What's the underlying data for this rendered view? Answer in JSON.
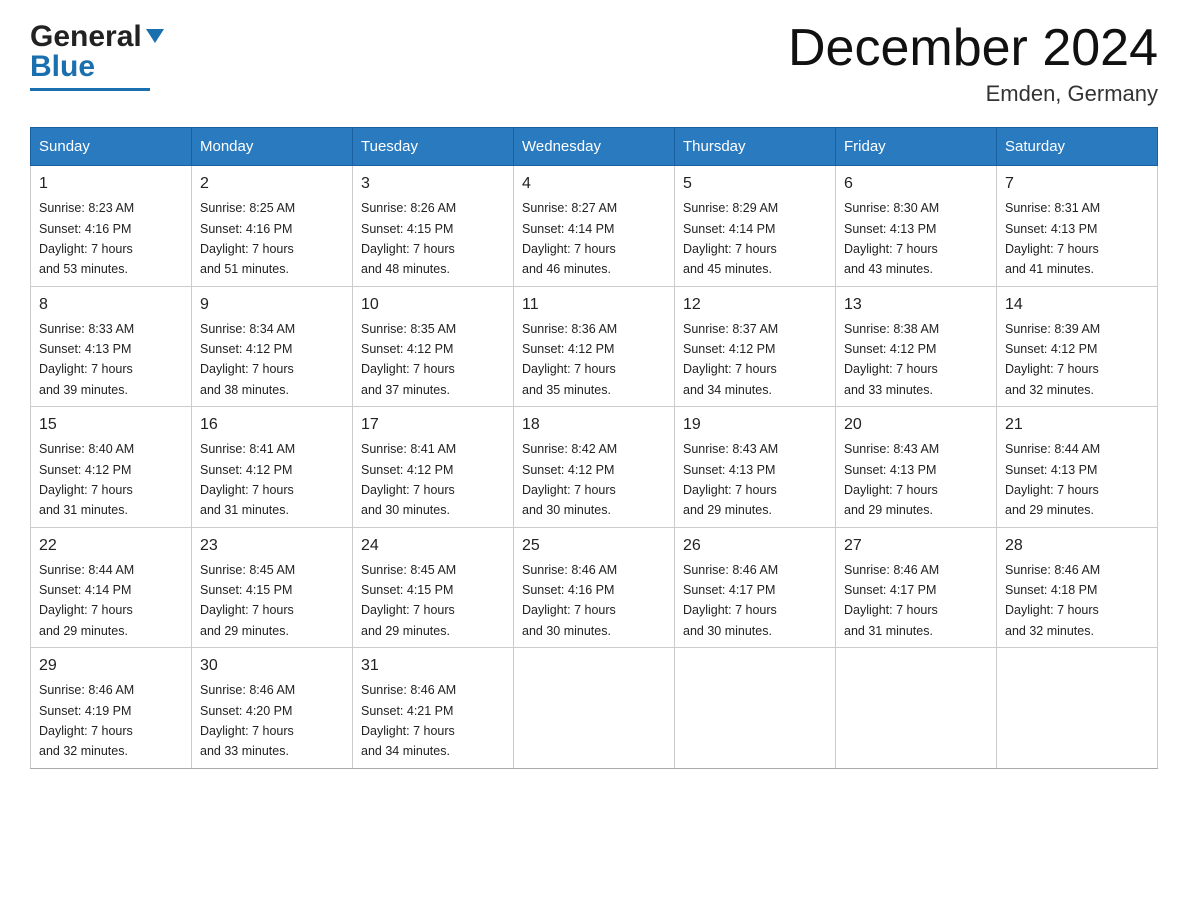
{
  "header": {
    "logo_general": "General",
    "logo_blue": "Blue",
    "title": "December 2024",
    "subtitle": "Emden, Germany"
  },
  "weekdays": [
    "Sunday",
    "Monday",
    "Tuesday",
    "Wednesday",
    "Thursday",
    "Friday",
    "Saturday"
  ],
  "weeks": [
    [
      {
        "day": "1",
        "sunrise": "8:23 AM",
        "sunset": "4:16 PM",
        "daylight": "7 hours and 53 minutes."
      },
      {
        "day": "2",
        "sunrise": "8:25 AM",
        "sunset": "4:16 PM",
        "daylight": "7 hours and 51 minutes."
      },
      {
        "day": "3",
        "sunrise": "8:26 AM",
        "sunset": "4:15 PM",
        "daylight": "7 hours and 48 minutes."
      },
      {
        "day": "4",
        "sunrise": "8:27 AM",
        "sunset": "4:14 PM",
        "daylight": "7 hours and 46 minutes."
      },
      {
        "day": "5",
        "sunrise": "8:29 AM",
        "sunset": "4:14 PM",
        "daylight": "7 hours and 45 minutes."
      },
      {
        "day": "6",
        "sunrise": "8:30 AM",
        "sunset": "4:13 PM",
        "daylight": "7 hours and 43 minutes."
      },
      {
        "day": "7",
        "sunrise": "8:31 AM",
        "sunset": "4:13 PM",
        "daylight": "7 hours and 41 minutes."
      }
    ],
    [
      {
        "day": "8",
        "sunrise": "8:33 AM",
        "sunset": "4:13 PM",
        "daylight": "7 hours and 39 minutes."
      },
      {
        "day": "9",
        "sunrise": "8:34 AM",
        "sunset": "4:12 PM",
        "daylight": "7 hours and 38 minutes."
      },
      {
        "day": "10",
        "sunrise": "8:35 AM",
        "sunset": "4:12 PM",
        "daylight": "7 hours and 37 minutes."
      },
      {
        "day": "11",
        "sunrise": "8:36 AM",
        "sunset": "4:12 PM",
        "daylight": "7 hours and 35 minutes."
      },
      {
        "day": "12",
        "sunrise": "8:37 AM",
        "sunset": "4:12 PM",
        "daylight": "7 hours and 34 minutes."
      },
      {
        "day": "13",
        "sunrise": "8:38 AM",
        "sunset": "4:12 PM",
        "daylight": "7 hours and 33 minutes."
      },
      {
        "day": "14",
        "sunrise": "8:39 AM",
        "sunset": "4:12 PM",
        "daylight": "7 hours and 32 minutes."
      }
    ],
    [
      {
        "day": "15",
        "sunrise": "8:40 AM",
        "sunset": "4:12 PM",
        "daylight": "7 hours and 31 minutes."
      },
      {
        "day": "16",
        "sunrise": "8:41 AM",
        "sunset": "4:12 PM",
        "daylight": "7 hours and 31 minutes."
      },
      {
        "day": "17",
        "sunrise": "8:41 AM",
        "sunset": "4:12 PM",
        "daylight": "7 hours and 30 minutes."
      },
      {
        "day": "18",
        "sunrise": "8:42 AM",
        "sunset": "4:12 PM",
        "daylight": "7 hours and 30 minutes."
      },
      {
        "day": "19",
        "sunrise": "8:43 AM",
        "sunset": "4:13 PM",
        "daylight": "7 hours and 29 minutes."
      },
      {
        "day": "20",
        "sunrise": "8:43 AM",
        "sunset": "4:13 PM",
        "daylight": "7 hours and 29 minutes."
      },
      {
        "day": "21",
        "sunrise": "8:44 AM",
        "sunset": "4:13 PM",
        "daylight": "7 hours and 29 minutes."
      }
    ],
    [
      {
        "day": "22",
        "sunrise": "8:44 AM",
        "sunset": "4:14 PM",
        "daylight": "7 hours and 29 minutes."
      },
      {
        "day": "23",
        "sunrise": "8:45 AM",
        "sunset": "4:15 PM",
        "daylight": "7 hours and 29 minutes."
      },
      {
        "day": "24",
        "sunrise": "8:45 AM",
        "sunset": "4:15 PM",
        "daylight": "7 hours and 29 minutes."
      },
      {
        "day": "25",
        "sunrise": "8:46 AM",
        "sunset": "4:16 PM",
        "daylight": "7 hours and 30 minutes."
      },
      {
        "day": "26",
        "sunrise": "8:46 AM",
        "sunset": "4:17 PM",
        "daylight": "7 hours and 30 minutes."
      },
      {
        "day": "27",
        "sunrise": "8:46 AM",
        "sunset": "4:17 PM",
        "daylight": "7 hours and 31 minutes."
      },
      {
        "day": "28",
        "sunrise": "8:46 AM",
        "sunset": "4:18 PM",
        "daylight": "7 hours and 32 minutes."
      }
    ],
    [
      {
        "day": "29",
        "sunrise": "8:46 AM",
        "sunset": "4:19 PM",
        "daylight": "7 hours and 32 minutes."
      },
      {
        "day": "30",
        "sunrise": "8:46 AM",
        "sunset": "4:20 PM",
        "daylight": "7 hours and 33 minutes."
      },
      {
        "day": "31",
        "sunrise": "8:46 AM",
        "sunset": "4:21 PM",
        "daylight": "7 hours and 34 minutes."
      },
      null,
      null,
      null,
      null
    ]
  ],
  "labels": {
    "sunrise": "Sunrise:",
    "sunset": "Sunset:",
    "daylight": "Daylight:"
  }
}
